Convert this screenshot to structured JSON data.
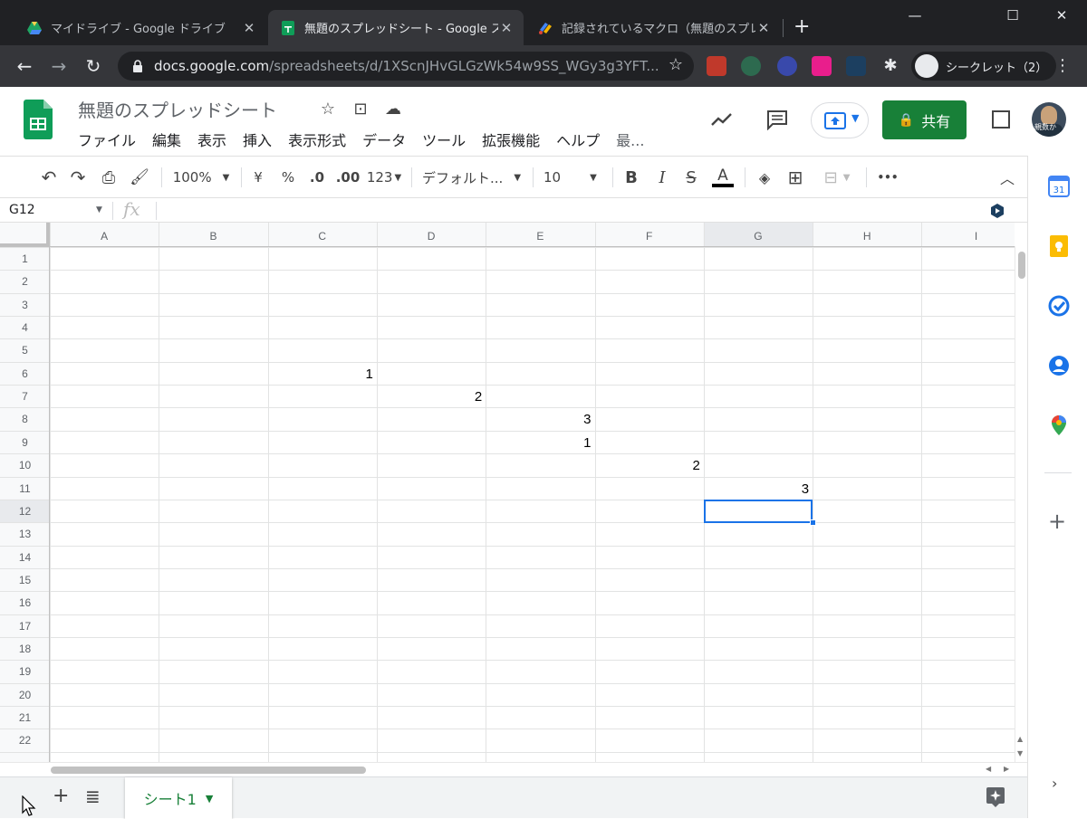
{
  "browser": {
    "tabs": [
      {
        "title": "マイドライブ - Google ドライブ",
        "icon": "google-drive-icon",
        "active": false
      },
      {
        "title": "無題のスプレッドシート - Google スプ",
        "icon": "google-sheets-icon",
        "active": true
      },
      {
        "title": "記録されているマクロ（無題のスプレ",
        "icon": "apps-script-icon",
        "active": false
      }
    ],
    "url_host": "docs.google.com",
    "url_path": "/spreadsheets/d/1XScnJHvGLGzWk54w9SS_WGy3g3YFT...",
    "incognito_label": "シークレット（2）"
  },
  "sheet": {
    "title": "無題のスプレッドシート",
    "menus": [
      "ファイル",
      "編集",
      "表示",
      "挿入",
      "表示形式",
      "データ",
      "ツール",
      "拡張機能",
      "ヘルプ"
    ],
    "menu_more": "最...",
    "share_label": "共有",
    "avatar_text": "親数か"
  },
  "toolbar": {
    "zoom": "100%",
    "currency": "¥",
    "percent": "%",
    "dec_decrease": ".0",
    "dec_increase": ".00",
    "format_123": "123",
    "font": "デフォルト...",
    "font_size": "10",
    "bold": "B",
    "italic": "I",
    "strike": "S",
    "text_color_glyph": "A",
    "more": "•••"
  },
  "formula": {
    "name_box": "G12",
    "fx": "fx",
    "value": ""
  },
  "grid": {
    "columns": [
      "A",
      "B",
      "C",
      "D",
      "E",
      "F",
      "G",
      "H",
      "I"
    ],
    "rows": [
      "1",
      "2",
      "3",
      "4",
      "5",
      "6",
      "7",
      "8",
      "9",
      "10",
      "11",
      "12",
      "13",
      "14",
      "15",
      "16",
      "17",
      "18",
      "19",
      "20",
      "21",
      "22"
    ],
    "selected": {
      "col": "G",
      "row": 12
    },
    "cells": [
      {
        "col": "C",
        "row": 6,
        "value": "1"
      },
      {
        "col": "D",
        "row": 7,
        "value": "2"
      },
      {
        "col": "E",
        "row": 8,
        "value": "3"
      },
      {
        "col": "E",
        "row": 9,
        "value": "1"
      },
      {
        "col": "F",
        "row": 10,
        "value": "2"
      },
      {
        "col": "G",
        "row": 11,
        "value": "3"
      }
    ]
  },
  "bottom": {
    "sheet_tab": "シート1"
  },
  "colors": {
    "accent_green": "#188038",
    "selection_blue": "#1a73e8"
  }
}
